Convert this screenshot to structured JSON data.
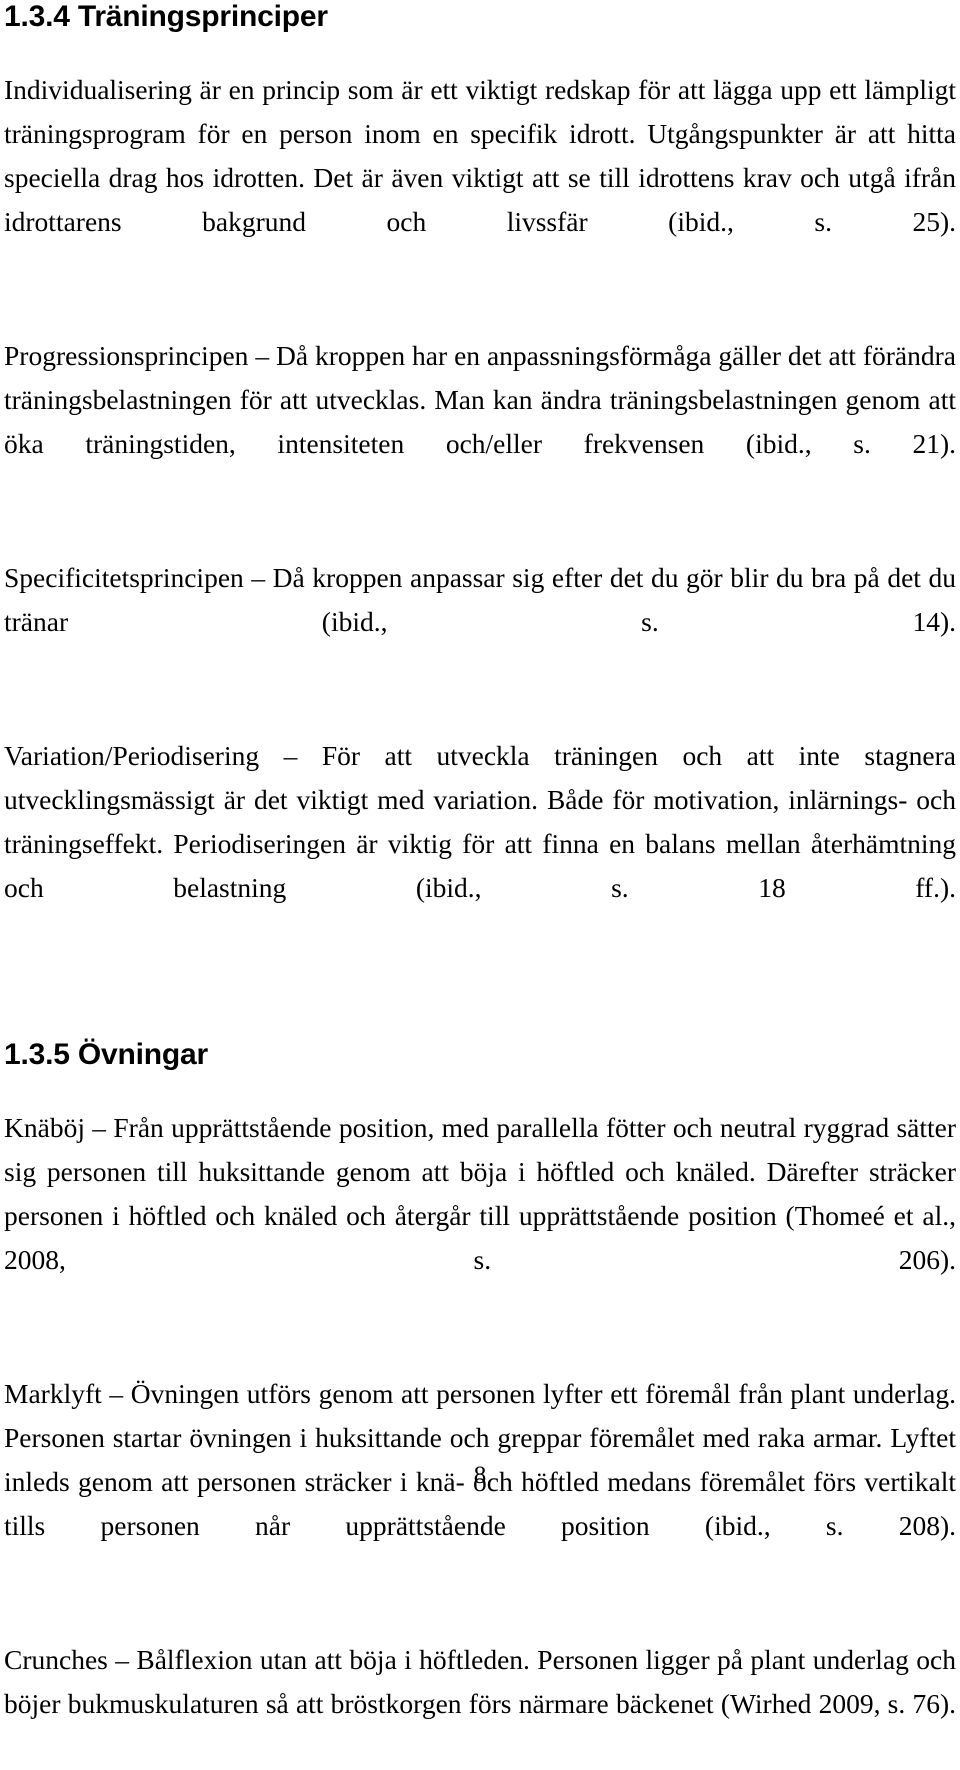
{
  "document": {
    "language": "sv",
    "page_number": "8",
    "background_color": "#ffffff",
    "text_color": "#000000"
  },
  "sections": [
    {
      "heading": "1.3.4 Träningsprinciper",
      "paragraphs": [
        "Individualisering är en princip som är ett viktigt redskap för att lägga upp ett lämpligt träningsprogram för en person inom en specifik idrott. Utgångspunkter är att hitta speciella drag hos idrotten. Det är även viktigt att se till idrottens krav och utgå ifrån idrottarens bakgrund och livssfär (ibid., s. 25).",
        "Progressionsprincipen – Då kroppen har en anpassningsförmåga gäller det att förändra träningsbelastningen för att utvecklas. Man kan ändra träningsbelastningen genom att öka träningstiden, intensiteten och/eller frekvensen (ibid., s. 21).",
        "Specificitetsprincipen – Då kroppen anpassar sig efter det du gör blir du bra på det du tränar (ibid., s. 14).",
        "Variation/Periodisering – För att utveckla träningen och att inte stagnera utvecklingsmässigt är det viktigt med variation. Både för motivation, inlärnings- och träningseffekt. Periodiseringen är viktig för att finna en balans mellan återhämtning och belastning (ibid., s. 18 ff.)."
      ]
    },
    {
      "heading": "1.3.5 Övningar",
      "paragraphs": [
        "Knäböj – Från upprättstående position, med parallella fötter och neutral ryggrad sätter sig personen till huksittande genom att böja i höftled och knäled. Därefter sträcker personen i höftled och knäled och återgår till upprättstående position (Thomeé et al., 2008, s. 206).",
        "Marklyft – Övningen utförs genom att personen lyfter ett föremål från plant underlag. Personen startar övningen i huksittande och greppar föremålet med raka armar. Lyftet inleds genom att personen sträcker i knä- och höftled medans föremålet förs vertikalt tills personen når upprättstående position (ibid., s. 208).",
        "Crunches – Bålflexion utan att böja i höftleden. Personen ligger på plant underlag och böjer bukmuskulaturen så att bröstkorgen förs närmare bäckenet (Wirhed 2009, s. 76)."
      ]
    }
  ],
  "footer": {
    "page_number": "8"
  }
}
